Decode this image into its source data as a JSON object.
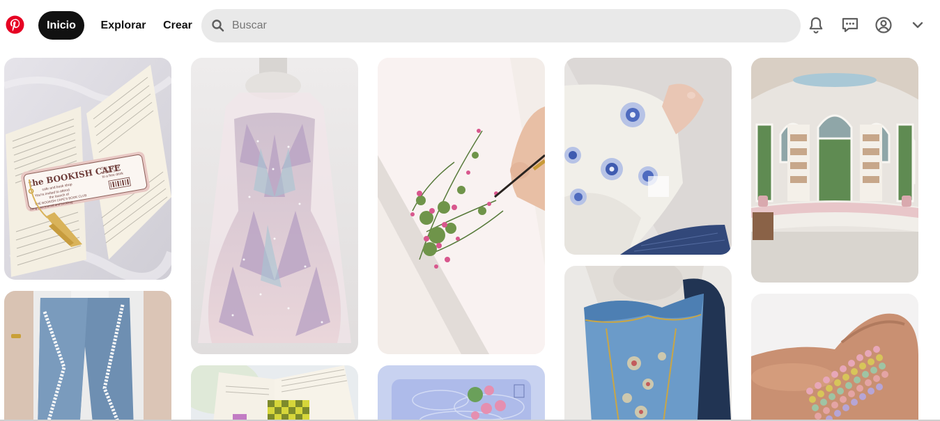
{
  "header": {
    "logo_icon": "pinterest-logo",
    "brand_color": "#e60023",
    "nav": {
      "home": "Inicio",
      "explore": "Explorar",
      "create": "Crear"
    },
    "search": {
      "placeholder": "Buscar",
      "icon": "search-icon"
    },
    "icons": [
      "bell-icon",
      "message-icon",
      "user-icon",
      "chevron-down-icon"
    ]
  },
  "pins": [
    {
      "label": "bookmark-book-pin",
      "text": {
        "title": "the BOOKISH CAFE",
        "subtitle": "cafe and book shop",
        "line1": "This voucher",
        "line2": "entitles you",
        "line3": "to a free drink",
        "line4": "You're invited to attend",
        "line5": "the launch of",
        "line6": "THE BOOKISH CAFE'S BOOK CLUB",
        "line7": "bring your journal and bookbag"
      }
    },
    {
      "label": "jeans-pin"
    },
    {
      "label": "gown-pin"
    },
    {
      "label": "reading-book-pin"
    },
    {
      "label": "painting-flowers-pin"
    },
    {
      "label": "pond-illustration-pin"
    },
    {
      "label": "embroidered-sleeve-pin"
    },
    {
      "label": "blue-corset-pin"
    },
    {
      "label": "library-room-pin"
    },
    {
      "label": "beads-hand-pin"
    }
  ]
}
